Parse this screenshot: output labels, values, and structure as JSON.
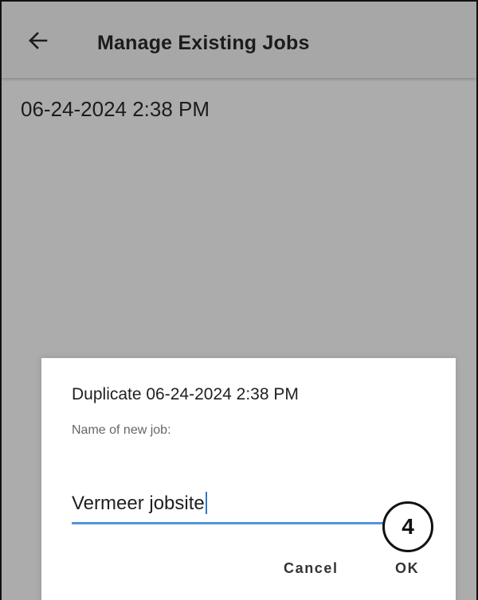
{
  "app_bar": {
    "title": "Manage Existing Jobs",
    "back_icon": "arrow-left-icon"
  },
  "job_list": {
    "items": [
      {
        "label": "06-24-2024 2:38 PM"
      }
    ]
  },
  "dialog": {
    "title": "Duplicate 06-24-2024 2:38 PM",
    "message": "Name of new job:",
    "input_value": "Vermeer jobsite",
    "cancel_label": "Cancel",
    "ok_label": "OK",
    "accent_color": "#4f95d8"
  },
  "callout": {
    "step": "4"
  }
}
